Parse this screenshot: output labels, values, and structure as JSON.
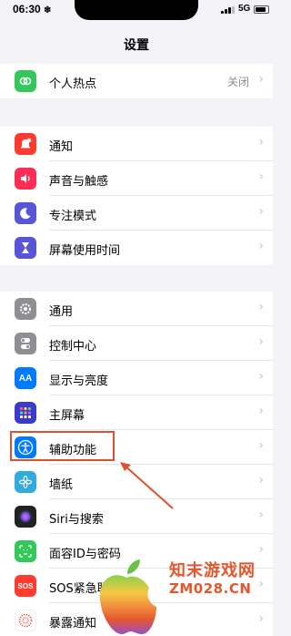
{
  "status": {
    "time": "06:30",
    "extra": "❄",
    "network": "5G"
  },
  "nav": {
    "title": "设置"
  },
  "groups": [
    {
      "rows": [
        {
          "label": "个人热点",
          "value": "关闭",
          "icon": "hotspot-icon",
          "color": "#34c759"
        }
      ]
    },
    {
      "rows": [
        {
          "label": "通知",
          "icon": "bell-icon",
          "color": "#ff3b30"
        },
        {
          "label": "声音与触感",
          "icon": "speaker-icon",
          "color": "#ff2d55"
        },
        {
          "label": "专注模式",
          "icon": "moon-icon",
          "color": "#5856d6"
        },
        {
          "label": "屏幕使用时间",
          "icon": "hourglass-icon",
          "color": "#5856d6"
        }
      ]
    },
    {
      "rows": [
        {
          "label": "通用",
          "icon": "gear-icon",
          "color": "#8e8e93"
        },
        {
          "label": "控制中心",
          "icon": "toggles-icon",
          "color": "#8e8e93"
        },
        {
          "label": "显示与亮度",
          "icon": "aa-icon",
          "color": "#007aff"
        },
        {
          "label": "主屏幕",
          "icon": "grid-icon",
          "color": "#3a3acd"
        },
        {
          "label": "辅助功能",
          "icon": "accessibility-icon",
          "color": "#007aff"
        },
        {
          "label": "墙纸",
          "icon": "flower-icon",
          "color": "#33aadc"
        },
        {
          "label": "Siri与搜索",
          "icon": "siri-icon",
          "color": "#222222"
        },
        {
          "label": "面容ID与密码",
          "icon": "faceid-icon",
          "color": "#34c759"
        },
        {
          "label": "SOS紧急联络",
          "icon": "sos-icon",
          "color": "#ff3b30"
        },
        {
          "label": "暴露通知",
          "icon": "exposure-icon",
          "color": "#ffffff"
        }
      ]
    }
  ],
  "watermark": {
    "line1": "知末游戏网",
    "line2": "ZM028.CN"
  }
}
